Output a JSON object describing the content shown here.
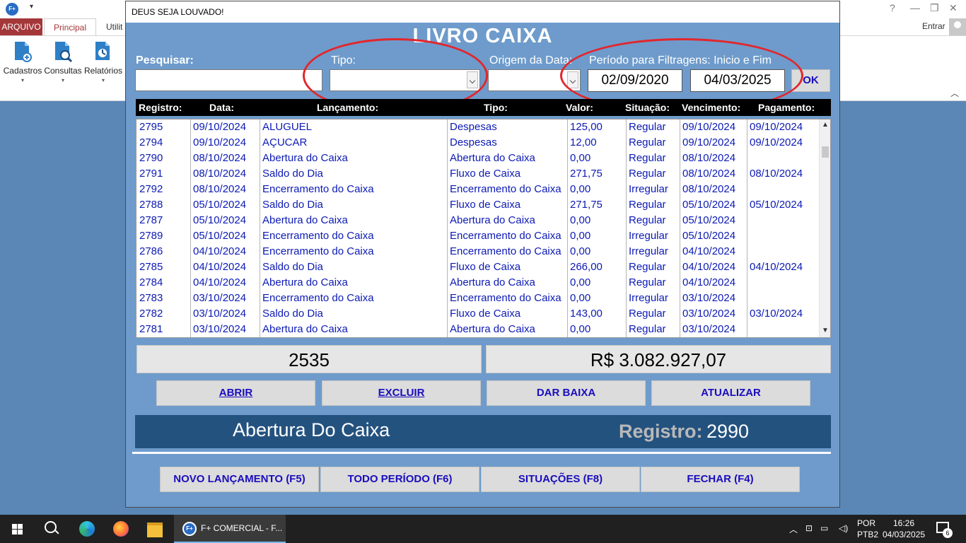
{
  "app": {
    "logo_text": "F+",
    "tabs": {
      "arquivo": "ARQUIVO",
      "principal": "Principal",
      "util": "Utilit"
    },
    "entrar": "Entrar",
    "ribbon": [
      {
        "label": "Cadastros"
      },
      {
        "label": "Consultas"
      },
      {
        "label": "Relatórios"
      }
    ]
  },
  "dialog": {
    "title": "DEUS SEJA LOUVADO!",
    "heading": "LIVRO CAIXA",
    "filters": {
      "pesquisar_label": "Pesquisar:",
      "tipo_label": "Tipo:",
      "origem_label": "Origem da Data:",
      "periodo_label": "Período para Filtragens: Inicio e Fim",
      "date_start": "02/09/2020",
      "date_end": "04/03/2025",
      "ok_label": "OK"
    },
    "table": {
      "headers": [
        "Registro:",
        "Data:",
        "Lançamento:",
        "Tipo:",
        "Valor:",
        "Situação:",
        "Vencimento:",
        "Pagamento:"
      ],
      "rows": [
        [
          "2795",
          "09/10/2024",
          "ALUGUEL",
          "Despesas",
          "125,00",
          "Regular",
          "09/10/2024",
          "09/10/2024"
        ],
        [
          "2794",
          "09/10/2024",
          "AÇUCAR",
          "Despesas",
          "12,00",
          "Regular",
          "09/10/2024",
          "09/10/2024"
        ],
        [
          "2790",
          "08/10/2024",
          "Abertura do Caixa",
          "Abertura do Caixa",
          "0,00",
          "Regular",
          "08/10/2024",
          ""
        ],
        [
          "2791",
          "08/10/2024",
          "Saldo do Dia",
          "Fluxo de Caixa",
          "271,75",
          "Regular",
          "08/10/2024",
          "08/10/2024"
        ],
        [
          "2792",
          "08/10/2024",
          "Encerramento do Caixa",
          "Encerramento do Caixa",
          "0,00",
          "Irregular",
          "08/10/2024",
          ""
        ],
        [
          "2788",
          "05/10/2024",
          "Saldo do Dia",
          "Fluxo de Caixa",
          "271,75",
          "Regular",
          "05/10/2024",
          "05/10/2024"
        ],
        [
          "2787",
          "05/10/2024",
          "Abertura do Caixa",
          "Abertura do Caixa",
          "0,00",
          "Regular",
          "05/10/2024",
          ""
        ],
        [
          "2789",
          "05/10/2024",
          "Encerramento do Caixa",
          "Encerramento do Caixa",
          "0,00",
          "Irregular",
          "05/10/2024",
          ""
        ],
        [
          "2786",
          "04/10/2024",
          "Encerramento do Caixa",
          "Encerramento do Caixa",
          "0,00",
          "Irregular",
          "04/10/2024",
          ""
        ],
        [
          "2785",
          "04/10/2024",
          "Saldo do Dia",
          "Fluxo de Caixa",
          "266,00",
          "Regular",
          "04/10/2024",
          "04/10/2024"
        ],
        [
          "2784",
          "04/10/2024",
          "Abertura do Caixa",
          "Abertura do Caixa",
          "0,00",
          "Regular",
          "04/10/2024",
          ""
        ],
        [
          "2783",
          "03/10/2024",
          "Encerramento do Caixa",
          "Encerramento do Caixa",
          "0,00",
          "Irregular",
          "03/10/2024",
          ""
        ],
        [
          "2782",
          "03/10/2024",
          "Saldo do Dia",
          "Fluxo de Caixa",
          "143,00",
          "Regular",
          "03/10/2024",
          "03/10/2024"
        ],
        [
          "2781",
          "03/10/2024",
          "Abertura do Caixa",
          "Abertura do Caixa",
          "0,00",
          "Regular",
          "03/10/2024",
          ""
        ]
      ]
    },
    "totals": {
      "count": "2535",
      "sum": "R$ 3.082.927,07"
    },
    "actions": {
      "abrir": "ABRIR",
      "excluir": "EXCLUIR",
      "dar_baixa": "DAR BAIXA",
      "atualizar": "ATUALIZAR"
    },
    "status": {
      "text": "Abertura Do Caixa",
      "registro_label": "Registro:",
      "registro_value": "2990"
    },
    "bottom_buttons": {
      "novo": "NOVO LANÇAMENTO (F5)",
      "todo": "TODO PERÍODO (F6)",
      "situacoes": "SITUAÇÕES (F8)",
      "fechar": "FECHAR (F4)"
    }
  },
  "taskbar": {
    "app_label": "F+ COMERCIAL - F...",
    "lang_1": "POR",
    "lang_2": "PTB2",
    "time": "16:26",
    "date": "04/03/2025",
    "notif_count": "6"
  },
  "colors": {
    "dialog_bg": "#6e9bcb",
    "status_bar": "#24527f",
    "link_blue": "#1a0dbd",
    "row_text": "#0c1ab4",
    "highlight_red": "#e2262c"
  }
}
